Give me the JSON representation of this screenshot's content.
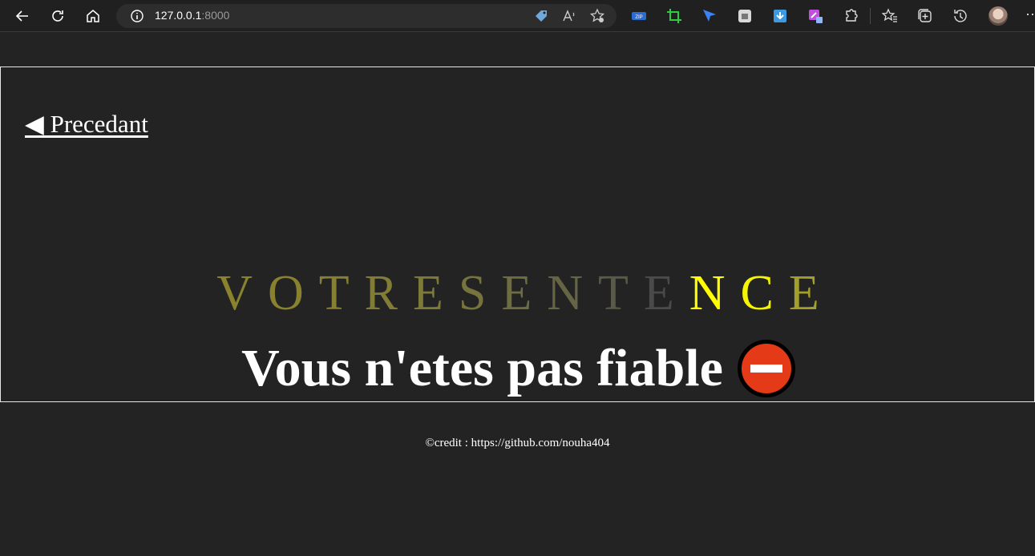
{
  "browser": {
    "url_host": "127.0.0.1",
    "url_port": ":8000",
    "icons": [
      "back-icon",
      "reload-icon",
      "home-icon",
      "info-icon",
      "tag-icon",
      "read-aloud-icon",
      "add-favorite-icon",
      "zip-extension-icon",
      "crop-extension-icon",
      "pointer-extension-icon",
      "screenshot-extension-icon",
      "download-extension-icon",
      "color-picker-extension-icon",
      "extensions-icon",
      "favorites-icon",
      "collections-icon",
      "history-icon",
      "profile-avatar",
      "more-icon"
    ]
  },
  "page": {
    "back_link": "◀ Precedant",
    "sentence_letters": [
      {
        "char": "V",
        "color": "#8a832d"
      },
      {
        "char": "O",
        "color": "#888230"
      },
      {
        "char": "T",
        "color": "#858033"
      },
      {
        "char": "R",
        "color": "#827d36"
      },
      {
        "char": "E",
        "color": "#7d7939"
      },
      {
        "char": "S",
        "color": "#76733d"
      },
      {
        "char": "E",
        "color": "#6e6c41"
      },
      {
        "char": "N",
        "color": "#656445"
      },
      {
        "char": "T",
        "color": "#5a5a48"
      },
      {
        "char": "E",
        "color": "#4a4a4a"
      },
      {
        "char": "N",
        "color": "#ffff00"
      },
      {
        "char": "C",
        "color": "#f5f500"
      },
      {
        "char": "E",
        "color": "#a39f2c"
      }
    ],
    "message": "Vous n'etes pas fiable",
    "status_icon": "no-entry-icon",
    "credit": "©credit : https://github.com/nouha404"
  }
}
